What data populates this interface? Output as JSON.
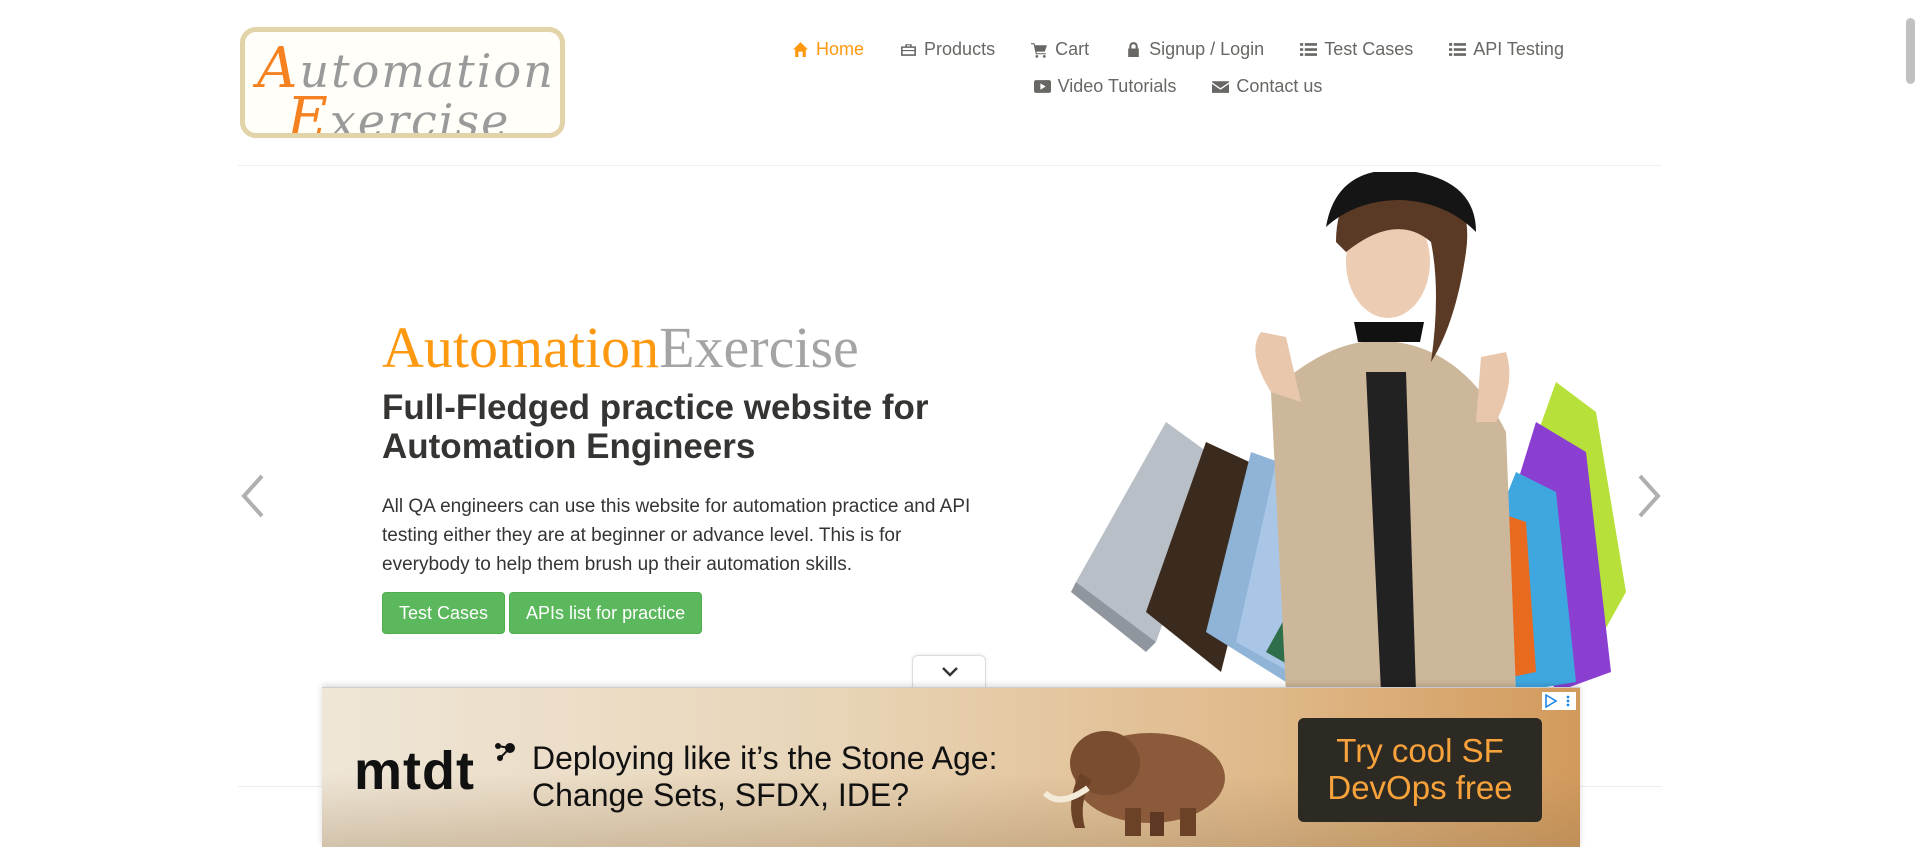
{
  "header": {
    "logo": {
      "line1": "Automation",
      "line2": "Exercise"
    },
    "nav": [
      {
        "label": "Home",
        "icon": "home-icon",
        "active": true
      },
      {
        "label": "Products",
        "icon": "briefcase-icon"
      },
      {
        "label": "Cart",
        "icon": "cart-icon"
      },
      {
        "label": "Signup / Login",
        "icon": "lock-icon"
      },
      {
        "label": "Test Cases",
        "icon": "list-icon"
      },
      {
        "label": "API Testing",
        "icon": "list-icon"
      },
      {
        "label": "Video Tutorials",
        "icon": "youtube-play-icon"
      },
      {
        "label": "Contact us",
        "icon": "envelope-icon"
      }
    ]
  },
  "slide": {
    "brand_part1": "Automation",
    "brand_part2": "Exercise",
    "heading": "Full-Fledged practice website for Automation Engineers",
    "text": "All QA engineers can use this website for automation practice and API testing either they are at beginner or advance level. This is for everybody to help them brush up their automation skills.",
    "buttons": {
      "test_cases": "Test Cases",
      "apis_list": "APIs list for practice"
    }
  },
  "ad": {
    "logo": "mtdt",
    "text": "Deploying like it’s the Stone Age: Change Sets, SFDX, IDE?",
    "cta": "Try cool SF DevOps free"
  },
  "colors": {
    "accent": "#fe980f",
    "button": "#5cb85c",
    "text": "#696763",
    "heading": "#363432"
  }
}
